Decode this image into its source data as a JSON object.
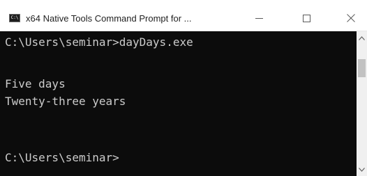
{
  "window": {
    "title": "x64 Native Tools Command Prompt for ...",
    "app_icon": "cmd-icon",
    "app_icon_text": "C:\\",
    "controls": {
      "minimize_icon": "minimize-icon",
      "maximize_icon": "maximize-icon",
      "close_icon": "close-icon"
    }
  },
  "console": {
    "background": "#0c0c0c",
    "foreground": "#cccccc",
    "lines": [
      "C:\\Users\\seminar>dayDays.exe",
      "",
      "Five days",
      "Twenty-three years",
      "",
      "",
      "C:\\Users\\seminar>"
    ]
  },
  "scrollbar": {
    "up_icon": "chevron-up-icon",
    "down_icon": "chevron-down-icon"
  }
}
